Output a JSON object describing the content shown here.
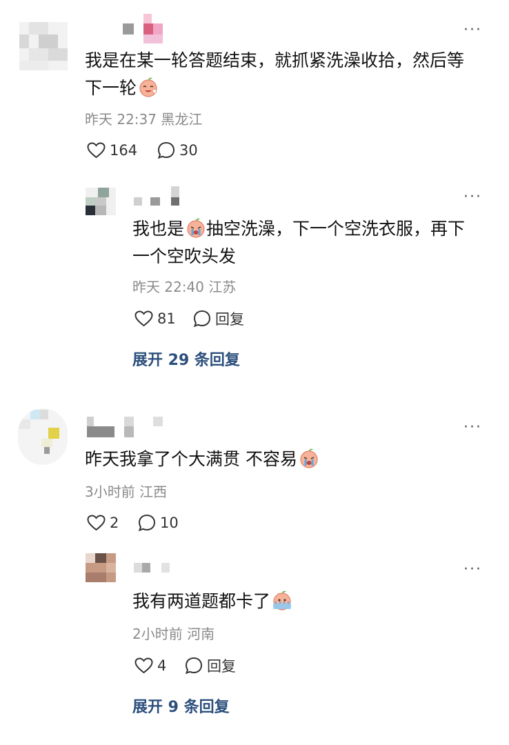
{
  "comments": [
    {
      "text_parts": [
        "我是在某一轮答题结束，就抓紧洗澡收拾，然后等",
        "下一轮"
      ],
      "time": "昨天 22:37",
      "location": "黑龙江",
      "likes": "164",
      "replies": "30",
      "emoji": "peach-laugh-emoji"
    },
    {
      "text_parts": [
        "我也是",
        "抽空洗澡，下一个空洗衣服，再下",
        "一个空吹头发"
      ],
      "time": "昨天 22:40",
      "location": "江苏",
      "likes": "81",
      "reply_label": "回复",
      "emoji": "peach-cry-emoji"
    },
    {
      "expand": "展开 29 条回复"
    },
    {
      "text_parts": [
        "昨天我拿了个大满贯 不容易"
      ],
      "time": "3小时前",
      "location": "江西",
      "likes": "2",
      "replies": "10",
      "emoji": "peach-cry-emoji"
    },
    {
      "text_parts": [
        "我有两道题都卡了"
      ],
      "time": "2小时前",
      "location": "河南",
      "likes": "4",
      "reply_label": "回复",
      "emoji": "peach-sweat-emoji"
    },
    {
      "expand": "展开 9 条回复"
    }
  ],
  "more_label": "···",
  "colors": {
    "link": "#2c4f7c",
    "meta": "#8a8a8a",
    "text": "#111111"
  }
}
